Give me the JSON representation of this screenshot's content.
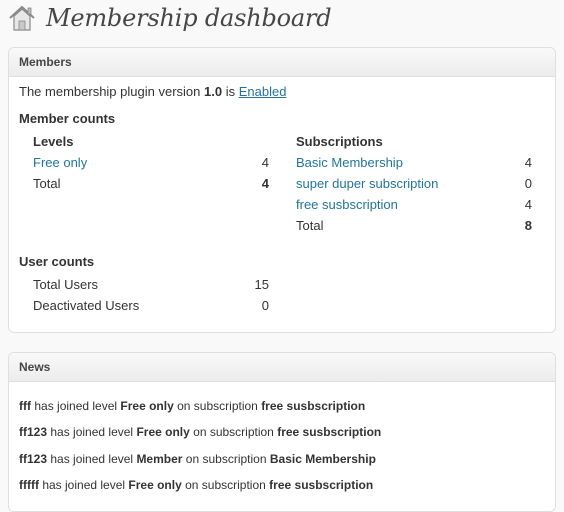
{
  "header": {
    "icon": "house-icon",
    "title": "Membership dashboard"
  },
  "members_box": {
    "title": "Members",
    "status_prefix": "The membership plugin version",
    "version": "1.0",
    "status_middle": "is",
    "status_link": "Enabled",
    "member_counts_heading": "Member counts",
    "levels": {
      "heading": "Levels",
      "rows": [
        {
          "name": "Free only",
          "count": "4"
        }
      ],
      "total_label": "Total",
      "total_count": "4"
    },
    "subscriptions": {
      "heading": "Subscriptions",
      "rows": [
        {
          "name": "Basic Membership",
          "count": "4"
        },
        {
          "name": "super duper subscription",
          "count": "0"
        },
        {
          "name": "free susbscription",
          "count": "4"
        }
      ],
      "total_label": "Total",
      "total_count": "8"
    },
    "user_counts": {
      "heading": "User counts",
      "rows": [
        {
          "label": "Total Users",
          "count": "15"
        },
        {
          "label": "Deactivated Users",
          "count": "0"
        }
      ]
    }
  },
  "news_box": {
    "title": "News",
    "items": [
      {
        "user": "fff",
        "t1": "has joined level",
        "level": "Free only",
        "t2": "on subscription",
        "sub": "free susbscription"
      },
      {
        "user": "ff123",
        "t1": "has joined level",
        "level": "Free only",
        "t2": "on subscription",
        "sub": "free susbscription"
      },
      {
        "user": "ff123",
        "t1": "has joined level",
        "level": "Member",
        "t2": "on subscription",
        "sub": "Basic Membership"
      },
      {
        "user": "fffff",
        "t1": "has joined level",
        "level": "Free only",
        "t2": "on subscription",
        "sub": "free susbscription"
      }
    ]
  }
}
